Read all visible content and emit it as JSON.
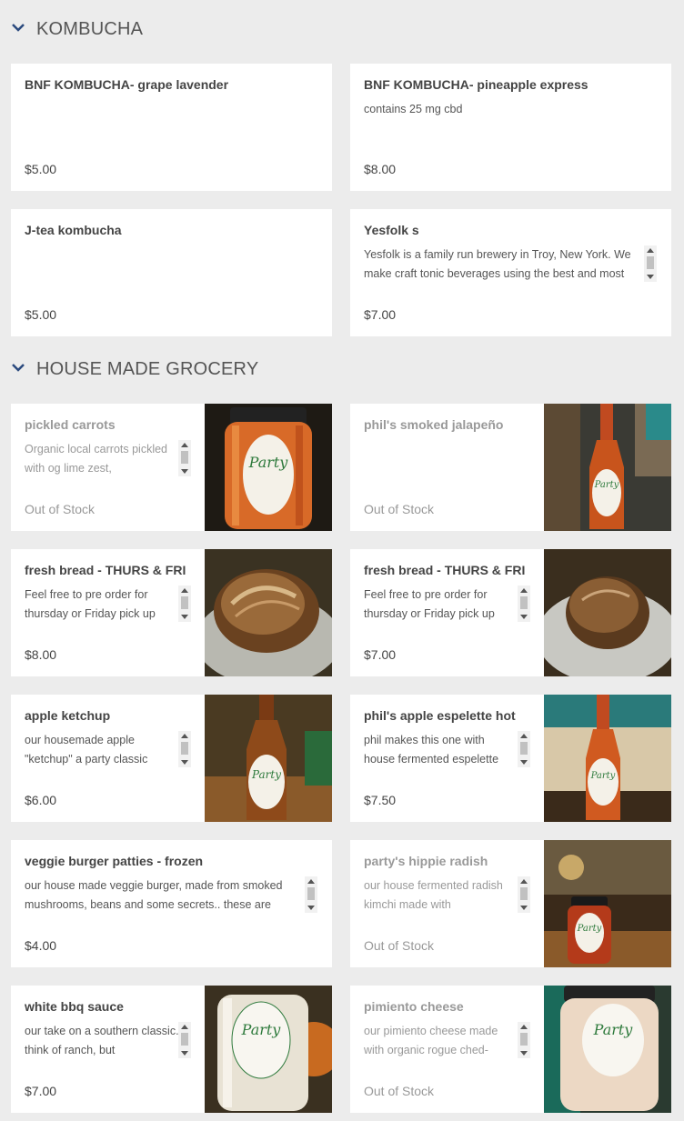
{
  "sections": {
    "kombucha": {
      "title": "KOMBUCHA"
    },
    "grocery": {
      "title": "HOUSE MADE GROCERY"
    }
  },
  "kombucha_items": [
    {
      "name": "BNF KOMBUCHA- grape lavender",
      "description": "",
      "price": "$5.00"
    },
    {
      "name": "BNF KOMBUCHA- pineapple express",
      "description": "contains 25 mg cbd",
      "price": "$8.00"
    },
    {
      "name": "J-tea kombucha",
      "description": "",
      "price": "$5.00"
    },
    {
      "name": "Yesfolk s",
      "description": "Yesfolk is a family run brewery in Troy, New York. We make craft tonic beverages using the best and most",
      "price": "$7.00"
    }
  ],
  "grocery_items": [
    {
      "name": "pickled carrots",
      "description": "Organic local carrots pickled with og lime zest,",
      "price": "Out of Stock",
      "photo_icon": "jar-photo"
    },
    {
      "name": "phil's smoked jalapeño",
      "description": "",
      "price": "Out of Stock",
      "photo_icon": "bottle-photo"
    },
    {
      "name": "fresh bread - THURS & FRI",
      "description": "Feel free to pre order for thursday or Friday pick up",
      "price": "$8.00",
      "photo_icon": "bread-photo"
    },
    {
      "name": "fresh bread - THURS & FRI",
      "description": "Feel free to pre order for thursday or Friday pick up",
      "price": "$7.00",
      "photo_icon": "bread-photo"
    },
    {
      "name": "apple ketchup",
      "description": "our housemade apple \"ketchup\"  a party classic",
      "price": "$6.00",
      "photo_icon": "bottle-photo"
    },
    {
      "name": "phil's apple espelette hot",
      "description": "phil makes this one with house fermented espelette",
      "price": "$7.50",
      "photo_icon": "bottle-photo"
    },
    {
      "name": "veggie burger patties - frozen",
      "description": "our house made veggie burger, made from smoked mushrooms, beans and some secrets..  these are",
      "price": "$4.00"
    },
    {
      "name": "party's hippie radish",
      "description": "our house fermented radish kimchi made with",
      "price": "Out of Stock",
      "photo_icon": "jar-photo"
    },
    {
      "name": "white bbq sauce",
      "description": "our take on a southern classic.  think of ranch, but",
      "price": "$7.00",
      "photo_icon": "jar-photo"
    },
    {
      "name": "pimiento cheese",
      "description": "our pimiento cheese made with organic rogue ched-",
      "price": "Out of Stock",
      "photo_icon": "jar-photo"
    }
  ],
  "colors": {
    "accent": "#2b4a7e",
    "background": "#ececec",
    "card": "#ffffff",
    "out_of_stock": "#999999"
  }
}
